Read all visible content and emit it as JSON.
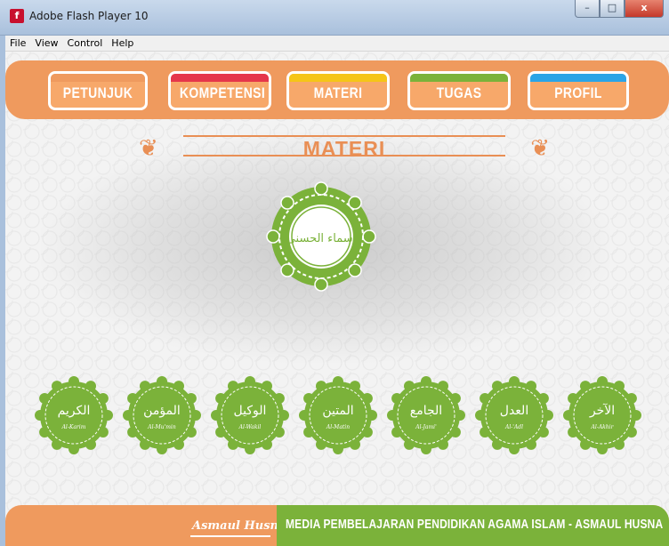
{
  "window": {
    "title": "Adobe Flash Player 10",
    "minimize": "–",
    "maximize": "□",
    "close": "x"
  },
  "menu": [
    "File",
    "View",
    "Control",
    "Help"
  ],
  "nav": [
    {
      "label": "PETUNJUK",
      "accent": "#ef9a5e"
    },
    {
      "label": "KOMPETENSI",
      "accent": "#e5364b"
    },
    {
      "label": "MATERI",
      "accent": "#f5c518"
    },
    {
      "label": "TUGAS",
      "accent": "#7bb23a"
    },
    {
      "label": "PROFIL",
      "accent": "#2aa4e6"
    }
  ],
  "heading": "MATERI",
  "center_medallion": {
    "arabic": "اسماء الحسنى"
  },
  "names": [
    {
      "arabic": "الكريم",
      "latin": "Al-Karim"
    },
    {
      "arabic": "المؤمن",
      "latin": "Al-Mu'min"
    },
    {
      "arabic": "الوكيل",
      "latin": "Al-Wakil"
    },
    {
      "arabic": "المتين",
      "latin": "Al-Matin"
    },
    {
      "arabic": "الجامع",
      "latin": "Al-Jami'"
    },
    {
      "arabic": "العدل",
      "latin": "Al-'Adl"
    },
    {
      "arabic": "الآخر",
      "latin": "Al-Akhir"
    }
  ],
  "footer": {
    "logo": "Asmaul Husna",
    "text": "MEDIA PEMBELAJARAN PENDIDIKAN AGAMA ISLAM - ASMAUL HUSNA"
  },
  "colors": {
    "orange": "#ef9a5e",
    "green": "#7bb23a",
    "white": "#ffffff"
  }
}
